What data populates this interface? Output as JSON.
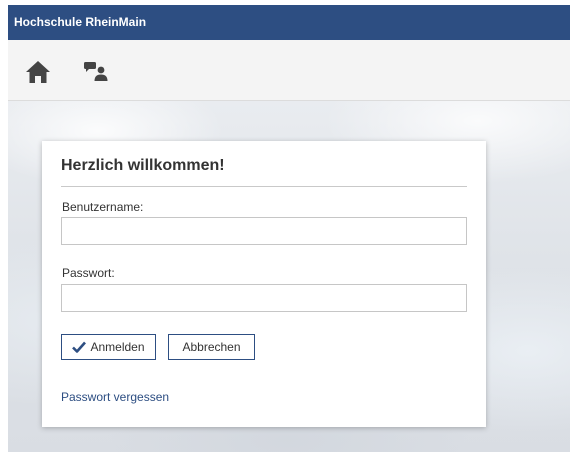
{
  "header": {
    "title": "Hochschule RheinMain"
  },
  "toolbar": {
    "icons": [
      "home-icon",
      "chat-users-icon"
    ]
  },
  "login": {
    "heading": "Herzlich willkommen!",
    "username_label": "Benutzername:",
    "username_value": "",
    "password_label": "Passwort:",
    "password_value": "",
    "login_button": "Anmelden",
    "cancel_button": "Abbrechen",
    "forgot_link": "Passwort vergessen"
  },
  "colors": {
    "brand": "#2d4e82",
    "toolbar_bg": "#f4f4f4",
    "icon": "#444444"
  }
}
